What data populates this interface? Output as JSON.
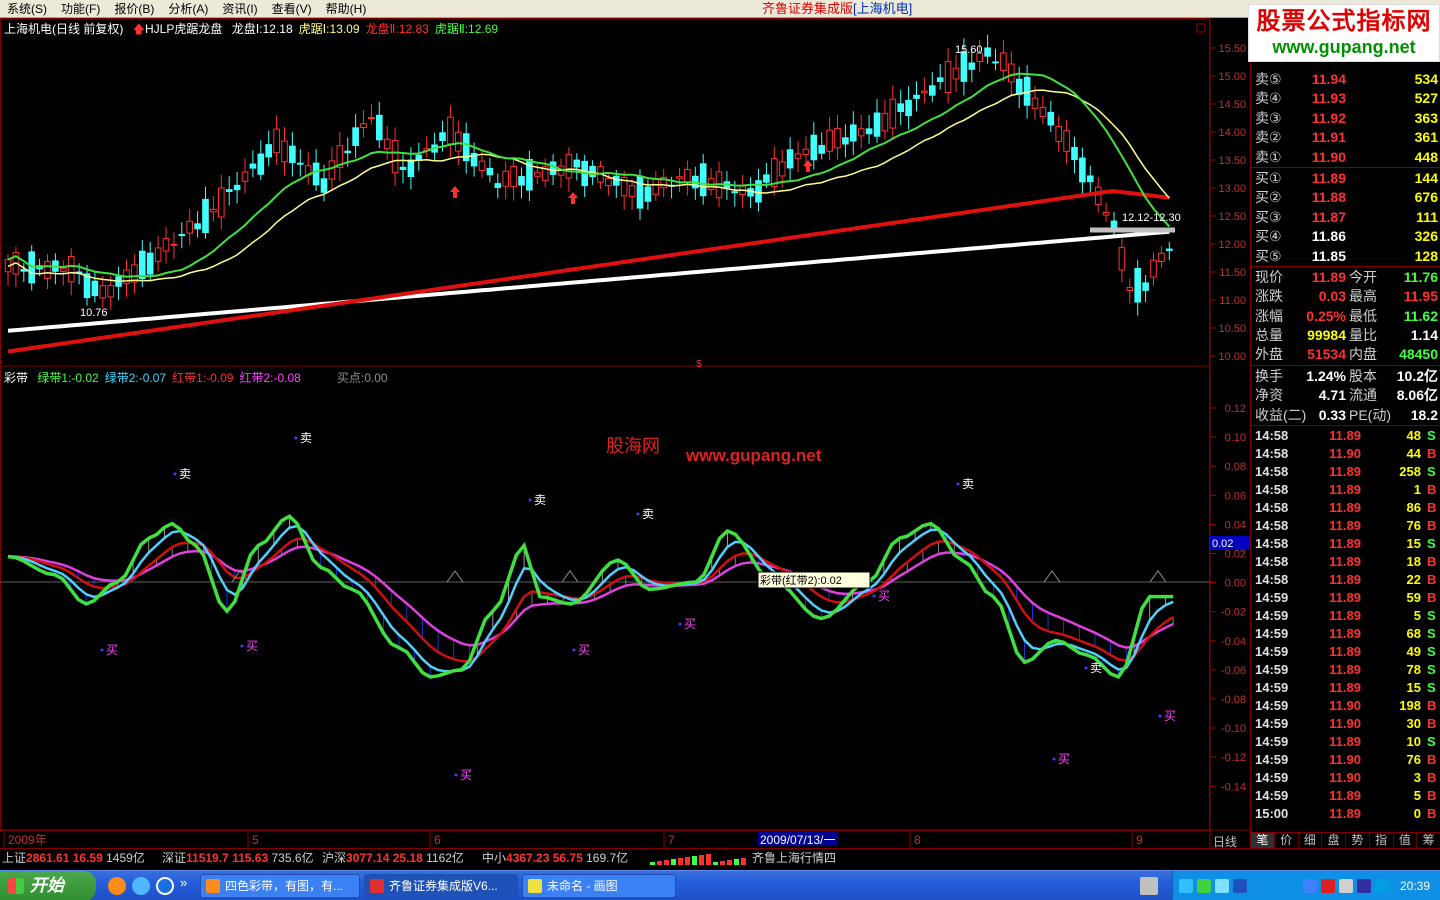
{
  "menu": [
    "系统(S)",
    "功能(F)",
    "报价(B)",
    "分析(A)",
    "资讯(I)",
    "查看(V)",
    "帮助(H)"
  ],
  "app_title": {
    "main": "齐鲁证券集成版",
    "sub": "[上海机电]"
  },
  "logo": {
    "line1": "股票公式指标网",
    "line2": "www.gupang.net"
  },
  "price_header": {
    "stock": "上海机电(日线 前复权)",
    "formula": "HJLP虎踞龙盘",
    "items": [
      {
        "label": "龙盘Ⅰ:12.18",
        "color": "#ffffff"
      },
      {
        "label": "虎踞Ⅰ:13.09",
        "color": "#ffff80"
      },
      {
        "label": "龙盘Ⅱ:12.83",
        "color": "#ff3030"
      },
      {
        "label": "虎踞Ⅱ:12.69",
        "color": "#40ff40"
      }
    ]
  },
  "ind_header": {
    "name": "彩带",
    "items": [
      {
        "label": "绿带1:-0.02",
        "color": "#40ff40"
      },
      {
        "label": "绿带2:-0.07",
        "color": "#40d8ff"
      },
      {
        "label": "红带1:-0.09",
        "color": "#ff3030"
      },
      {
        "label": "红带2:-0.08",
        "color": "#ff40ff"
      },
      {
        "label": "买点:0.00",
        "color": "#909090"
      }
    ]
  },
  "price_axis": [
    "15.50",
    "15.00",
    "14.50",
    "14.00",
    "13.50",
    "13.00",
    "12.50",
    "12.00",
    "11.50",
    "11.00",
    "10.50",
    "10.00"
  ],
  "ind_axis": [
    "0.12",
    "0.10",
    "0.08",
    "0.06",
    "0.04",
    "0.02",
    "0.00",
    "-0.02",
    "-0.04",
    "-0.06",
    "-0.08",
    "-0.10",
    "-0.12",
    "-0.14"
  ],
  "x_axis": {
    "labels": [
      "2009年",
      "5",
      "6",
      "7",
      "8",
      "9"
    ],
    "cursor_date": "2009/07/13/一",
    "period": "日线"
  },
  "annotations": {
    "high": "15.60",
    "low": "10.76",
    "range": "12.12-12.30",
    "cursor_value": "0.02",
    "tooltip": "彩带(红带2):0.02",
    "watermark_cn": "股海网",
    "watermark_url": "www.gupang.net",
    "buy": "买",
    "sell": "卖"
  },
  "quote": {
    "sells": [
      {
        "label": "卖⑤",
        "price": "11.94",
        "vol": "534"
      },
      {
        "label": "卖④",
        "price": "11.93",
        "vol": "527"
      },
      {
        "label": "卖③",
        "price": "11.92",
        "vol": "363"
      },
      {
        "label": "卖②",
        "price": "11.91",
        "vol": "361"
      },
      {
        "label": "卖①",
        "price": "11.90",
        "vol": "448"
      }
    ],
    "buys": [
      {
        "label": "买①",
        "price": "11.89",
        "vol": "144"
      },
      {
        "label": "买②",
        "price": "11.88",
        "vol": "676"
      },
      {
        "label": "买③",
        "price": "11.87",
        "vol": "111"
      },
      {
        "label": "买④",
        "price": "11.86",
        "vol": "326"
      },
      {
        "label": "买⑤",
        "price": "11.85",
        "vol": "128"
      }
    ],
    "stats": [
      {
        "l1": "现价",
        "v1": "11.89",
        "c1": "#ff3030",
        "l2": "今开",
        "v2": "11.76",
        "c2": "#40ff40"
      },
      {
        "l1": "涨跌",
        "v1": "0.03",
        "c1": "#ff3030",
        "l2": "最高",
        "v2": "11.95",
        "c2": "#ff3030"
      },
      {
        "l1": "涨幅",
        "v1": "0.25%",
        "c1": "#ff3030",
        "l2": "最低",
        "v2": "11.62",
        "c2": "#40ff40"
      },
      {
        "l1": "总量",
        "v1": "99984",
        "c1": "#ffff00",
        "l2": "量比",
        "v2": "1.14",
        "c2": "#ffffff"
      },
      {
        "l1": "外盘",
        "v1": "51534",
        "c1": "#ff3030",
        "l2": "内盘",
        "v2": "48450",
        "c2": "#40ff40"
      }
    ],
    "fund": [
      {
        "l1": "换手",
        "v1": "1.24%",
        "l2": "股本",
        "v2": "10.2亿"
      },
      {
        "l1": "净资",
        "v1": "4.71",
        "l2": "流通",
        "v2": "8.06亿"
      },
      {
        "l1": "收益(二)",
        "v1": "0.33",
        "l2": "PE(动)",
        "v2": "18.2"
      }
    ]
  },
  "ticks": [
    {
      "t": "14:58",
      "p": "11.89",
      "q": "48",
      "d": "S"
    },
    {
      "t": "14:58",
      "p": "11.90",
      "q": "44",
      "d": "B"
    },
    {
      "t": "14:58",
      "p": "11.89",
      "q": "258",
      "d": "S"
    },
    {
      "t": "14:58",
      "p": "11.89",
      "q": "1",
      "d": "B"
    },
    {
      "t": "14:58",
      "p": "11.89",
      "q": "86",
      "d": "B"
    },
    {
      "t": "14:58",
      "p": "11.89",
      "q": "76",
      "d": "B"
    },
    {
      "t": "14:58",
      "p": "11.89",
      "q": "15",
      "d": "S"
    },
    {
      "t": "14:58",
      "p": "11.89",
      "q": "18",
      "d": "B"
    },
    {
      "t": "14:58",
      "p": "11.89",
      "q": "22",
      "d": "B"
    },
    {
      "t": "14:59",
      "p": "11.89",
      "q": "59",
      "d": "B"
    },
    {
      "t": "14:59",
      "p": "11.89",
      "q": "5",
      "d": "S"
    },
    {
      "t": "14:59",
      "p": "11.89",
      "q": "68",
      "d": "S"
    },
    {
      "t": "14:59",
      "p": "11.89",
      "q": "49",
      "d": "S"
    },
    {
      "t": "14:59",
      "p": "11.89",
      "q": "78",
      "d": "S"
    },
    {
      "t": "14:59",
      "p": "11.89",
      "q": "15",
      "d": "S"
    },
    {
      "t": "14:59",
      "p": "11.90",
      "q": "198",
      "d": "B"
    },
    {
      "t": "14:59",
      "p": "11.90",
      "q": "30",
      "d": "B"
    },
    {
      "t": "14:59",
      "p": "11.89",
      "q": "10",
      "d": "S"
    },
    {
      "t": "14:59",
      "p": "11.90",
      "q": "76",
      "d": "B"
    },
    {
      "t": "14:59",
      "p": "11.90",
      "q": "3",
      "d": "B"
    },
    {
      "t": "14:59",
      "p": "11.89",
      "q": "5",
      "d": "B"
    },
    {
      "t": "15:00",
      "p": "11.89",
      "q": "0",
      "d": "B"
    }
  ],
  "rp_tabs": [
    "笔",
    "价",
    "细",
    "盘",
    "势",
    "指",
    "值",
    "筹"
  ],
  "indices": [
    {
      "name": "上证",
      "val": "2861.61",
      "chg": "16.59",
      "amt": "1459亿"
    },
    {
      "name": "深证",
      "val": "11519.7",
      "chg": "115.63",
      "amt": "735.6亿"
    },
    {
      "name": "沪深",
      "val": "3077.14",
      "chg": "25.18",
      "amt": "1162亿"
    },
    {
      "name": "中小",
      "val": "4367.23",
      "chg": "56.75",
      "amt": "169.7亿"
    }
  ],
  "ticker": "齐鲁上海行情四",
  "taskbar": {
    "start": "开始",
    "tasks": [
      "四色彩带，有图，有...",
      "齐鲁证券集成版V6...",
      "未命名 - 画图"
    ],
    "clock": "20:39"
  },
  "colors": {
    "up": "#ff3030",
    "down": "#40ffff",
    "frame": "#800000"
  }
}
